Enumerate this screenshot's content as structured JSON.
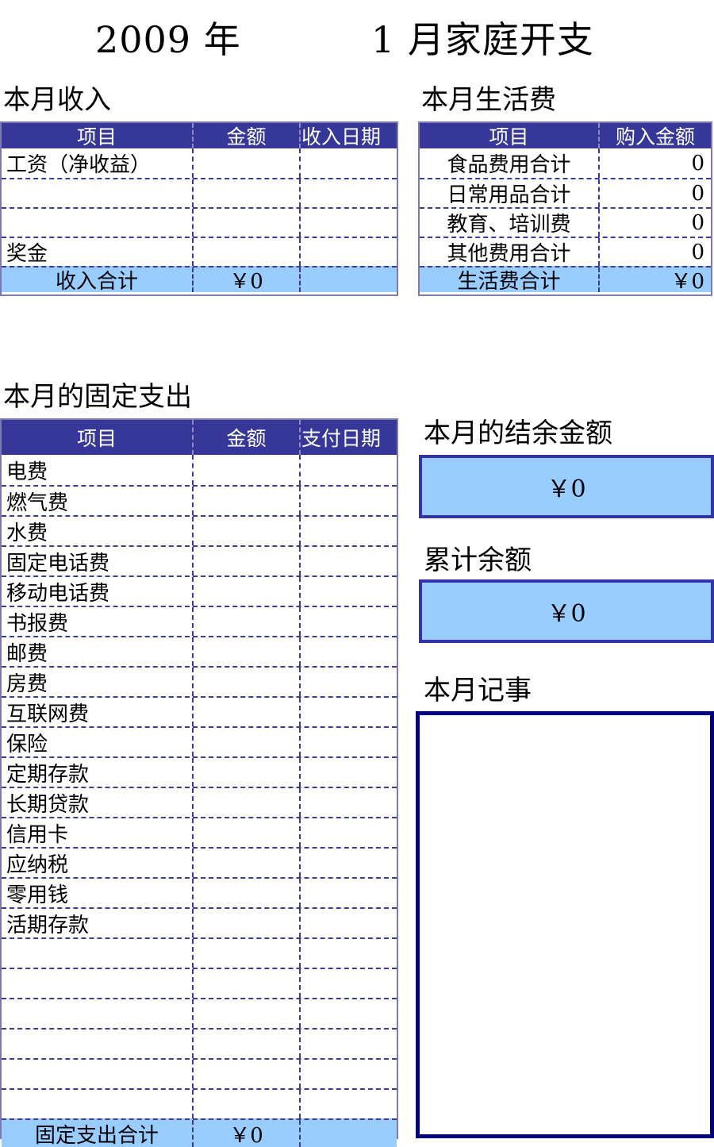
{
  "title": {
    "year": "2009 年",
    "main": "1 月家庭开支"
  },
  "colors": {
    "header_bg": "#373799",
    "total_bg": "#99CCFF",
    "grid": "#3A3A9C",
    "outer_border": "#7B7BB0",
    "notes_border": "#000080"
  },
  "income": {
    "heading": "本月收入",
    "columns": [
      "项目",
      "金额",
      "收入日期"
    ],
    "rows": [
      {
        "item": "工资（净收益）",
        "amount": "",
        "date": ""
      },
      {
        "item": "",
        "amount": "",
        "date": ""
      },
      {
        "item": "",
        "amount": "",
        "date": ""
      },
      {
        "item": "奖金",
        "amount": "",
        "date": ""
      }
    ],
    "total_label": "收入合计",
    "total_amount": "￥0",
    "total_date": ""
  },
  "living": {
    "heading": "本月生活费",
    "columns": [
      "项目",
      "购入金额"
    ],
    "rows": [
      {
        "item": "食品费用合计",
        "amount": "0"
      },
      {
        "item": "日常用品合计",
        "amount": "0"
      },
      {
        "item": "教育、培训费",
        "amount": "0"
      },
      {
        "item": "其他费用合计",
        "amount": "0"
      }
    ],
    "total_label": "生活费合计",
    "total_amount": "￥0"
  },
  "fixed": {
    "heading": "本月的固定支出",
    "columns": [
      "项目",
      "金额",
      "支付日期"
    ],
    "rows": [
      {
        "item": "电费",
        "amount": "",
        "date": ""
      },
      {
        "item": "燃气费",
        "amount": "",
        "date": ""
      },
      {
        "item": "水费",
        "amount": "",
        "date": ""
      },
      {
        "item": "固定电话费",
        "amount": "",
        "date": ""
      },
      {
        "item": "移动电话费",
        "amount": "",
        "date": ""
      },
      {
        "item": "书报费",
        "amount": "",
        "date": ""
      },
      {
        "item": "邮费",
        "amount": "",
        "date": ""
      },
      {
        "item": "房费",
        "amount": "",
        "date": ""
      },
      {
        "item": "互联网费",
        "amount": "",
        "date": ""
      },
      {
        "item": "保险",
        "amount": "",
        "date": ""
      },
      {
        "item": "定期存款",
        "amount": "",
        "date": ""
      },
      {
        "item": "长期贷款",
        "amount": "",
        "date": ""
      },
      {
        "item": "信用卡",
        "amount": "",
        "date": ""
      },
      {
        "item": "应纳税",
        "amount": "",
        "date": ""
      },
      {
        "item": "零用钱",
        "amount": "",
        "date": ""
      },
      {
        "item": "活期存款",
        "amount": "",
        "date": ""
      },
      {
        "item": "",
        "amount": "",
        "date": ""
      },
      {
        "item": "",
        "amount": "",
        "date": ""
      },
      {
        "item": "",
        "amount": "",
        "date": ""
      },
      {
        "item": "",
        "amount": "",
        "date": ""
      },
      {
        "item": "",
        "amount": "",
        "date": ""
      },
      {
        "item": "",
        "amount": "",
        "date": ""
      }
    ],
    "total_label": "固定支出合计",
    "total_amount": "￥0",
    "total_date": ""
  },
  "balance": {
    "heading": "本月的结余金额",
    "value": "￥0"
  },
  "cumulative": {
    "heading": "累计余额",
    "value": "￥0"
  },
  "notes": {
    "heading": "本月记事",
    "value": ""
  }
}
